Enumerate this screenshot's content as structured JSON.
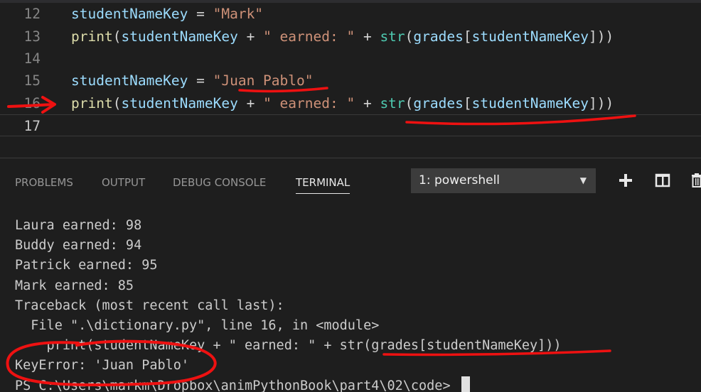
{
  "editor": {
    "lines": [
      {
        "num": "12",
        "parts": [
          [
            "var",
            "studentNameKey"
          ],
          [
            "op",
            " = "
          ],
          [
            "str",
            "\"Mark\""
          ]
        ]
      },
      {
        "num": "13",
        "parts": [
          [
            "fn",
            "print"
          ],
          [
            "op",
            "("
          ],
          [
            "var",
            "studentNameKey"
          ],
          [
            "op",
            " + "
          ],
          [
            "str",
            "\" earned: \""
          ],
          [
            "op",
            " + "
          ],
          [
            "bi",
            "str"
          ],
          [
            "op",
            "("
          ],
          [
            "var",
            "grades"
          ],
          [
            "op",
            "["
          ],
          [
            "var",
            "studentNameKey"
          ],
          [
            "op",
            "]))"
          ]
        ]
      },
      {
        "num": "14",
        "parts": []
      },
      {
        "num": "15",
        "parts": [
          [
            "var",
            "studentNameKey"
          ],
          [
            "op",
            " = "
          ],
          [
            "str",
            "\"Juan Pablo\""
          ]
        ]
      },
      {
        "num": "16",
        "parts": [
          [
            "fn",
            "print"
          ],
          [
            "op",
            "("
          ],
          [
            "var",
            "studentNameKey"
          ],
          [
            "op",
            " + "
          ],
          [
            "str",
            "\" earned: \""
          ],
          [
            "op",
            " + "
          ],
          [
            "bi",
            "str"
          ],
          [
            "op",
            "("
          ],
          [
            "var",
            "grades"
          ],
          [
            "op",
            "["
          ],
          [
            "var",
            "studentNameKey"
          ],
          [
            "op",
            "]))"
          ]
        ]
      },
      {
        "num": "17",
        "parts": []
      }
    ]
  },
  "panel": {
    "tabs": {
      "problems": "PROBLEMS",
      "output": "OUTPUT",
      "debug_console": "DEBUG CONSOLE",
      "terminal": "TERMINAL"
    },
    "terminal_selector": {
      "value": "1: powershell",
      "icon": "chevron-down-icon"
    },
    "toolbar_icons": [
      "plus-icon",
      "split-terminal-icon",
      "trash-icon"
    ]
  },
  "terminal": {
    "lines": [
      "Laura earned: 98",
      "Buddy earned: 94",
      "Patrick earned: 95",
      "Mark earned: 85",
      "Traceback (most recent call last):",
      "  File \".\\dictionary.py\", line 16, in <module>",
      "    print(studentNameKey + \" earned: \" + str(grades[studentNameKey]))",
      "KeyError: 'Juan Pablo'",
      "PS C:\\Users\\markm\\Dropbox\\animPythonBook\\part4\\02\\code> "
    ]
  },
  "colors": {
    "annotation": "#ee1111",
    "background": "#1e1e1e"
  }
}
